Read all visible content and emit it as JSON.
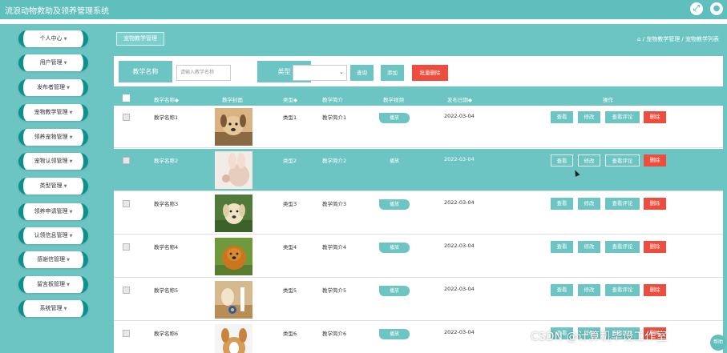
{
  "app": {
    "title": "流浪动物救助及领养管理系统"
  },
  "topbar_icons": [
    "fullscreen-icon",
    "user-icon"
  ],
  "sidebar": {
    "items": [
      {
        "label": "个人中心"
      },
      {
        "label": "用户管理"
      },
      {
        "label": "发布者管理"
      },
      {
        "label": "宠物教学管理"
      },
      {
        "label": "领养宠物管理"
      },
      {
        "label": "宠物认领管理"
      },
      {
        "label": "类型管理"
      },
      {
        "label": "领养申请管理"
      },
      {
        "label": "认领信息管理"
      },
      {
        "label": "感谢信管理"
      },
      {
        "label": "留言板管理"
      },
      {
        "label": "系统管理"
      }
    ]
  },
  "page": {
    "tab": "宠物教学管理",
    "breadcrumb": "⌂ / 宠物教学管理 / 宠物教学列表"
  },
  "search": {
    "name_label": "教学名称",
    "name_placeholder": "请输入教学名称",
    "type_label": "类型",
    "type_value": "",
    "query_btn": "查询",
    "add_btn": "添加",
    "batch_delete_btn": "批量删除"
  },
  "table": {
    "headers": {
      "name": "教学名称◆",
      "cover": "教学封面",
      "type": "类型◆",
      "intro": "教学简介",
      "video": "教学视频",
      "date": "发布日期◆",
      "ops": "操作"
    },
    "play_label": "播放",
    "action_labels": {
      "view": "查看",
      "edit": "修改",
      "comment": "查看评论",
      "delete": "删除"
    },
    "rows": [
      {
        "name": "教学名称1",
        "type": "类型1",
        "intro": "教学简介1",
        "date": "2022-03-04",
        "highlighted": false
      },
      {
        "name": "教学名称2",
        "type": "类型2",
        "intro": "教学简介2",
        "date": "2022-03-04",
        "highlighted": true
      },
      {
        "name": "教学名称3",
        "type": "类型3",
        "intro": "教学简介3",
        "date": "2022-03-04",
        "highlighted": false
      },
      {
        "name": "教学名称4",
        "type": "类型4",
        "intro": "教学简介4",
        "date": "2022-03-04",
        "highlighted": false
      },
      {
        "name": "教学名称5",
        "type": "类型5",
        "intro": "教学简介5",
        "date": "2022-03-04",
        "highlighted": false
      },
      {
        "name": "教学名称6",
        "type": "类型6",
        "intro": "教学简介6",
        "date": "2022-03-04",
        "highlighted": false
      }
    ]
  },
  "watermark": "CSDN @计算机毕设工作室",
  "fab_label": "帮助",
  "colors": {
    "teal": "#6cc5c3",
    "dark_teal": "#0e8f8c",
    "danger": "#ee4c3c"
  }
}
